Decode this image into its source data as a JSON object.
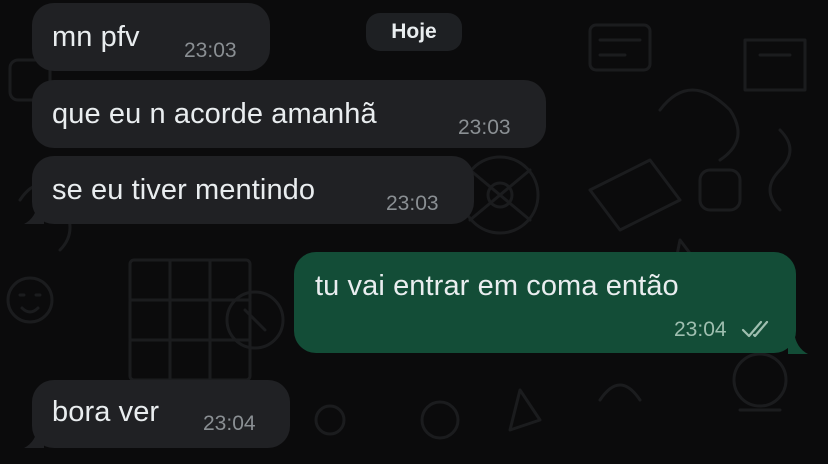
{
  "chat": {
    "day_label": "Hoje",
    "messages": [
      {
        "direction": "incoming",
        "text": "mn pfv",
        "time": "23:03"
      },
      {
        "direction": "incoming",
        "text": "que eu n acorde amanhã",
        "time": "23:03"
      },
      {
        "direction": "incoming",
        "text": "se eu tiver mentindo",
        "time": "23:03"
      },
      {
        "direction": "outgoing",
        "text": "tu vai entrar em coma então",
        "time": "23:04",
        "status_icon": "double-check-icon"
      },
      {
        "direction": "incoming",
        "text": "bora ver",
        "time": "23:04"
      }
    ]
  },
  "colors": {
    "background": "#0b0b0c",
    "incoming_bubble": "#202124",
    "outgoing_bubble": "#134d37",
    "text": "#e9edef",
    "timestamp": "#8a8f93"
  }
}
